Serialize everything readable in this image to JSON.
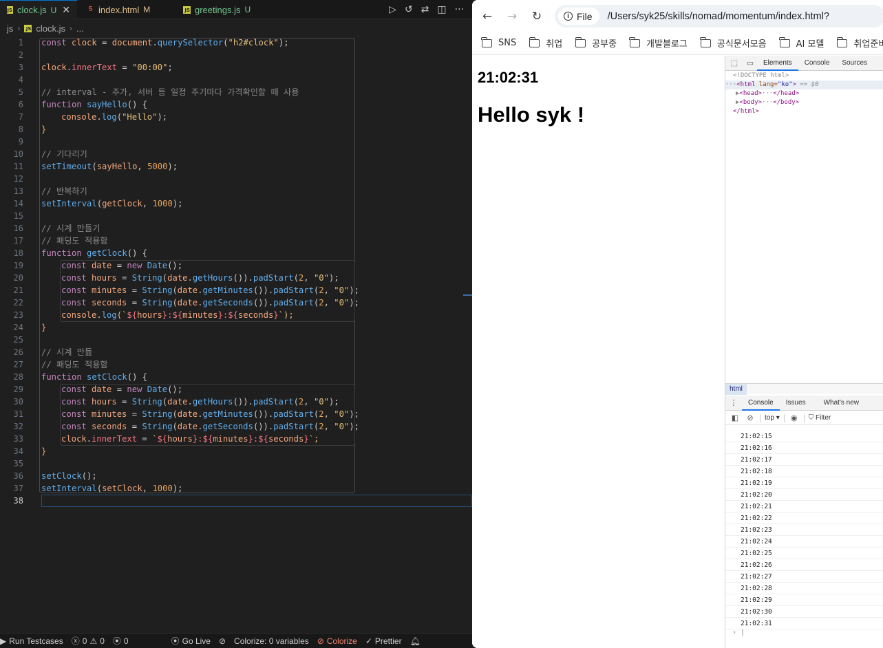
{
  "editor": {
    "tabs": [
      {
        "name": "clock.js",
        "status": "U",
        "type": "js",
        "active": true
      },
      {
        "name": "index.html",
        "status": "M",
        "type": "html",
        "active": false
      },
      {
        "name": "greetings.js",
        "status": "U",
        "type": "js",
        "active": false
      }
    ],
    "tab_actions": [
      "run-icon",
      "history-icon",
      "compare-changes-icon",
      "split-editor-icon",
      "more-icon"
    ],
    "breadcrumb": {
      "folder": "js",
      "file": "clock.js",
      "more": "..."
    },
    "line_numbers": [
      "1",
      "2",
      "3",
      "4",
      "5",
      "6",
      "7",
      "8",
      "9",
      "10",
      "11",
      "12",
      "13",
      "14",
      "15",
      "16",
      "17",
      "18",
      "19",
      "20",
      "21",
      "22",
      "23",
      "24",
      "25",
      "26",
      "27",
      "28",
      "29",
      "30",
      "31",
      "32",
      "33",
      "34",
      "35",
      "36",
      "37",
      "38"
    ],
    "current_line": "38",
    "code": {
      "l1": {
        "a": "const",
        "b": " clock",
        "c": " = ",
        "d": "document",
        "e": ".",
        "f": "querySelector",
        "g": "(",
        "h": "\"h2#clock\"",
        "i": ");"
      },
      "l3": {
        "a": "clock",
        "b": ".",
        "c": "innerText",
        "d": " = ",
        "e": "\"00:00\"",
        "f": ";"
      },
      "l5": "// interval - 주가, 서버 등 일정 주기마다 가격확인할 때 사용",
      "l6": {
        "a": "function",
        "b": " sayHello",
        "c": "() {"
      },
      "l7": {
        "a": "console",
        "b": ".",
        "c": "log",
        "d": "(",
        "e": "\"Hello\"",
        "f": ");"
      },
      "l8": "}",
      "l10": "// 기다리기",
      "l11": {
        "a": "setTimeout",
        "b": "(",
        "c": "sayHello",
        "d": ", ",
        "e": "5000",
        "f": ");"
      },
      "l13": "// 반복하기",
      "l14": {
        "a": "setInterval",
        "b": "(",
        "c": "getClock",
        "d": ", ",
        "e": "1000",
        "f": ");"
      },
      "l16": "// 시계 만들기",
      "l17": "// 패딩도 적용함",
      "l18": {
        "a": "function",
        "b": " getClock",
        "c": "() {"
      },
      "l19": {
        "a": "const",
        "b": " date",
        "c": " = ",
        "d": "new",
        "e": " Date",
        "f": "();"
      },
      "l20": {
        "a": "const",
        "b": " hours",
        "c": " = ",
        "d": "String",
        "e": "(",
        "f": "date",
        "g": ".",
        "h": "getHours",
        "i": "()).",
        "j": "padStart",
        "k": "(",
        "l": "2",
        "m": ", ",
        "n": "\"0\"",
        "o": ");"
      },
      "l21": {
        "a": "const",
        "b": " minutes",
        "c": " = ",
        "d": "String",
        "e": "(",
        "f": "date",
        "g": ".",
        "h": "getMinutes",
        "i": "()).",
        "j": "padStart",
        "k": "(",
        "l": "2",
        "m": ", ",
        "n": "\"0\"",
        "o": ");"
      },
      "l22": {
        "a": "const",
        "b": " seconds",
        "c": " = ",
        "d": "String",
        "e": "(",
        "f": "date",
        "g": ".",
        "h": "getSeconds",
        "i": "()).",
        "j": "padStart",
        "k": "(",
        "l": "2",
        "m": ", ",
        "n": "\"0\"",
        "o": ");"
      },
      "l23": {
        "a": "console",
        "b": ".",
        "c": "log",
        "d": "(`",
        "e": "${",
        "f": "hours",
        "g": "}:",
        "h": "${",
        "i": "minutes",
        "j": "}:",
        "k": "${",
        "l": "seconds",
        "m": "}",
        "n": "`);"
      },
      "l24": "}",
      "l26": "// 시계 만듦",
      "l27": "// 패딩도 적용함",
      "l28": {
        "a": "function",
        "b": " setClock",
        "c": "() {"
      },
      "l29": {
        "a": "const",
        "b": " date",
        "c": " = ",
        "d": "new",
        "e": " Date",
        "f": "();"
      },
      "l30": {
        "a": "const",
        "b": " hours",
        "c": " = ",
        "d": "String",
        "e": "(",
        "f": "date",
        "g": ".",
        "h": "getHours",
        "i": "()).",
        "j": "padStart",
        "k": "(",
        "l": "2",
        "m": ", ",
        "n": "\"0\"",
        "o": ");"
      },
      "l31": {
        "a": "const",
        "b": " minutes",
        "c": " = ",
        "d": "String",
        "e": "(",
        "f": "date",
        "g": ".",
        "h": "getMinutes",
        "i": "()).",
        "j": "padStart",
        "k": "(",
        "l": "2",
        "m": ", ",
        "n": "\"0\"",
        "o": ");"
      },
      "l32": {
        "a": "const",
        "b": " seconds",
        "c": " = ",
        "d": "String",
        "e": "(",
        "f": "date",
        "g": ".",
        "h": "getSeconds",
        "i": "()).",
        "j": "padStart",
        "k": "(",
        "l": "2",
        "m": ", ",
        "n": "\"0\"",
        "o": ");"
      },
      "l33": {
        "a": "clock",
        "b": ".",
        "c": "innerText",
        "d": " = ",
        "e": "`",
        "f": "${",
        "g": "hours",
        "h": "}:",
        "i": "${",
        "j": "minutes",
        "k": "}:",
        "l": "${",
        "m": "seconds",
        "n": "}",
        "o": "`;"
      },
      "l34": "}",
      "l36": {
        "a": "setClock",
        "b": "();"
      },
      "l37": {
        "a": "setInterval",
        "b": "(",
        "c": "setClock",
        "d": ", ",
        "e": "1000",
        "f": ");"
      }
    },
    "statusbar": {
      "run_testcases": "Run Testcases",
      "errors": "0",
      "warnings": "0",
      "ports": "0",
      "go_live": "Go Live",
      "colorize_vars": "Colorize: 0 variables",
      "colorize": "Colorize",
      "prettier": "Prettier"
    }
  },
  "browser": {
    "nav": {
      "back": "←",
      "forward": "→",
      "reload": "↻"
    },
    "url_chip": "File",
    "url": "/Users/syk25/skills/nomad/momentum/index.html?",
    "bookmarks": [
      "SNS",
      "취업",
      "공부중",
      "개발블로그",
      "공식문서모음",
      "AI 모델",
      "취업준비자료"
    ],
    "page": {
      "clock": "21:02:31",
      "greeting": "Hello syk !"
    },
    "devtools": {
      "tabs": [
        "Elements",
        "Console",
        "Sources"
      ],
      "active_tab": "Elements",
      "dom": {
        "doctype": "<!DOCTYPE html>",
        "html_open_tag": "<html",
        "html_attr": " lang=",
        "html_attr_val": "\"ko\"",
        "html_close": ">",
        "selected_marker": " == $0",
        "head": "<head>",
        "head_close": "</head>",
        "body": "<body>",
        "body_close": "</body>",
        "html_end": "</html>",
        "ellipsis": "···"
      },
      "crumb": "html",
      "drawer_tabs": [
        "Console",
        "Issues",
        "What's new"
      ],
      "context": "top",
      "filter_placeholder": "Filter",
      "console_lines": [
        "21:02:15",
        "21:02:16",
        "21:02:17",
        "21:02:18",
        "21:02:19",
        "21:02:20",
        "21:02:21",
        "21:02:22",
        "21:02:23",
        "21:02:24",
        "21:02:25",
        "21:02:26",
        "21:02:27",
        "21:02:28",
        "21:02:29",
        "21:02:30",
        "21:02:31"
      ],
      "prompt": "›"
    }
  }
}
